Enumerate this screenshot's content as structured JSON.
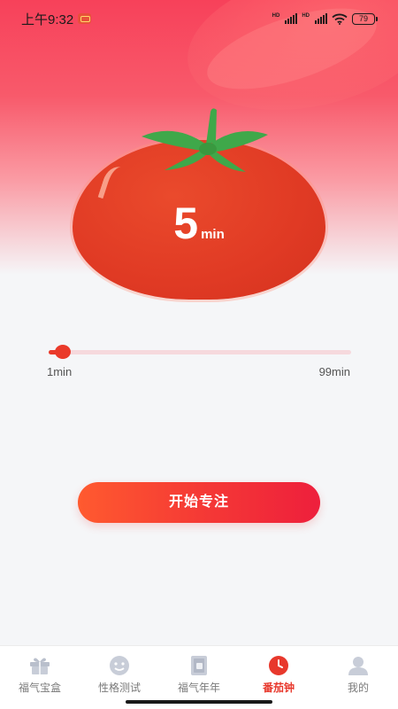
{
  "status_bar": {
    "time": "上午9:32",
    "battery": "79",
    "icons": [
      "notification-icon",
      "hd-signal-icon",
      "hd-signal-icon",
      "wifi-icon",
      "battery-icon"
    ]
  },
  "timer": {
    "value": "5",
    "unit": "min"
  },
  "slider": {
    "min_label": "1min",
    "max_label": "99min",
    "min": 1,
    "max": 99,
    "value": 5
  },
  "start_button": {
    "label": "开始专注"
  },
  "tabs": [
    {
      "label": "福气宝盒",
      "icon": "gift-box-icon",
      "active": false
    },
    {
      "label": "性格测试",
      "icon": "smiley-icon",
      "active": false
    },
    {
      "label": "福气年年",
      "icon": "calendar-book-icon",
      "active": false
    },
    {
      "label": "番茄钟",
      "icon": "clock-icon",
      "active": true
    },
    {
      "label": "我的",
      "icon": "user-icon",
      "active": false
    }
  ],
  "colors": {
    "accent": "#e8382c",
    "tomato": "#e03a24",
    "leaf": "#3fa84a",
    "tab_inactive": "#b9bfcc"
  }
}
